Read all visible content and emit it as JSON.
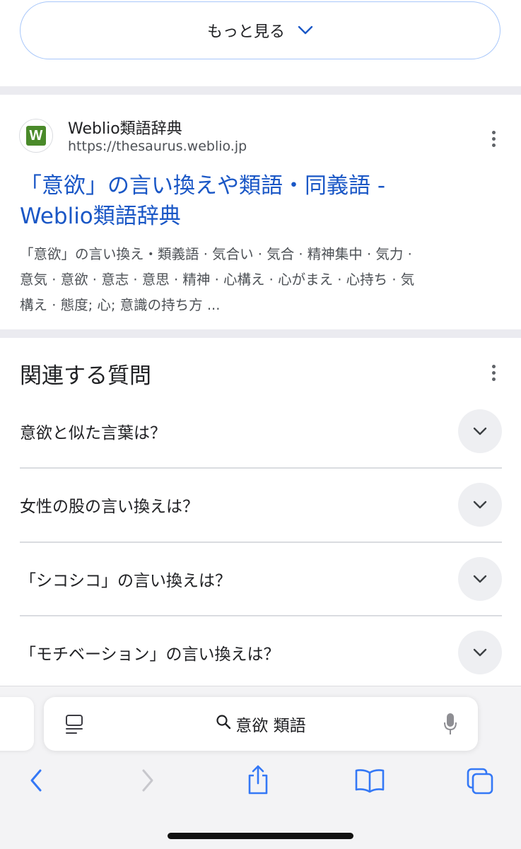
{
  "more_button": {
    "label": "もっと見る",
    "icon": "chevron-down-icon"
  },
  "result": {
    "favicon_letter": "W",
    "site_name": "Weblio類語辞典",
    "url": "https://thesaurus.weblio.jp",
    "title_line1": "「意欲」の言い換えや類語・同義語 -",
    "title_line2": "Weblio類語辞典",
    "snippet_line1": "「意欲」の言い換え・類義語 · 気合い · 気合 · 精神集中 · 気力 ·",
    "snippet_line2": "意気 · 意欲 · 意志 · 意思 · 精神 · 心構え · 心がまえ · 心持ち · 気",
    "snippet_line3": "構え · 態度; 心; 意識の持ち方 ...",
    "brand_color": "#4a8a2a",
    "link_color": "#1a57c6"
  },
  "related_questions": {
    "title": "関連する質問",
    "items": [
      {
        "text": "意欲と似た言葉は？"
      },
      {
        "text": "女性の股の言い換えは？"
      },
      {
        "text": "「シコシコ」の言い換えは？"
      },
      {
        "text": "「モチベーション」の言い換えは？"
      }
    ]
  },
  "browser": {
    "search_query": "意欲 類語",
    "icons": [
      "page-menu-icon",
      "search-icon",
      "microphone-icon",
      "back-icon",
      "forward-icon",
      "share-icon",
      "bookmarks-icon",
      "tabs-icon"
    ],
    "accent_color": "#3478f6"
  }
}
